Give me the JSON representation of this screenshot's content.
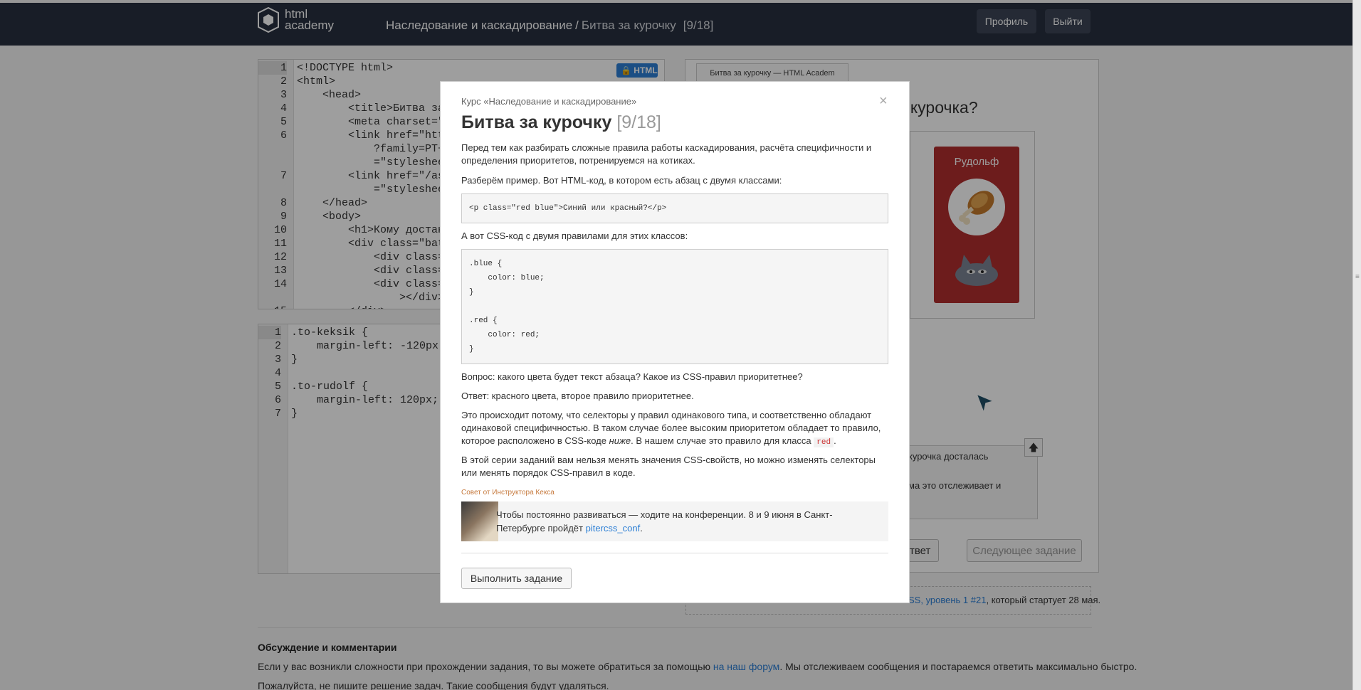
{
  "header": {
    "logo_line1": "html",
    "logo_line2": "academy",
    "breadcrumb_course": "Наследование и каскадирование",
    "breadcrumb_sep": "/",
    "breadcrumb_task": "Битва за курочку",
    "breadcrumb_count": "[9/18]",
    "profile_label": "Профиль",
    "logout_label": "Выйти"
  },
  "html_editor": {
    "badge": "HTML",
    "line_numbers": [
      "1",
      "2",
      "3",
      "4",
      "5",
      "6",
      "",
      "",
      "7",
      "",
      "8",
      "9",
      "10",
      "11",
      "12",
      "13",
      "14",
      "",
      "15"
    ],
    "lines": [
      "<!DOCTYPE html>",
      "<html>",
      "    <head>",
      "        <title>Битва за",
      "        <meta charset=\"",
      "        <link href=\"htt",
      "            ?family=PT+",
      "            =\"styleshee",
      "        <link href=\"/as",
      "            =\"styleshee",
      "    </head>",
      "    <body>",
      "        <h1>Кому достан",
      "        <div class=\"bat",
      "            <div class=",
      "            <div class=",
      "            <div class=",
      "                ></div>",
      "        </div>"
    ]
  },
  "css_editor": {
    "line_numbers": [
      "1",
      "2",
      "3",
      "4",
      "5",
      "6",
      "7"
    ],
    "lines": [
      ".to-keksik {",
      "    margin-left: -120px;",
      "}",
      "",
      ".to-rudolf {",
      "    margin-left: 120px;",
      "}"
    ]
  },
  "preview": {
    "tab_label": "Битва за курочку — HTML Academ",
    "heading": "я курочка?",
    "card_name": "Рудольф",
    "answer_line1": "курочка досталась",
    "answer_line2": "ма это отслеживает и",
    "up_arrow": "🡅",
    "answer_button": "твет",
    "next_button": "Следующее задание",
    "promo_link": "SS, уровень 1 #21",
    "promo_tail": ", который стартует 28 мая."
  },
  "discussion": {
    "heading": "Обсуждение и комментарии",
    "p1_start": "Если у вас возникли сложности при прохождении задания, то вы можете обратиться за помощью ",
    "p1_link": "на наш форум",
    "p1_end": ". Мы отслеживаем сообщения и постараемся ответить максимально быстро.",
    "p2": "Пожалуйста, не пишите решение задач. Такие сообщения будут удаляться."
  },
  "modal": {
    "course": "Курс «Наследование и каскадирование»",
    "close": "×",
    "title": "Битва за курочку",
    "title_count": "[9/18]",
    "intro": "Перед тем как разбирать сложные правила работы каскадирования, расчёта специфичности и определения приоритетов, потренируемся на котиках.",
    "example_intro": "Разберём пример. Вот HTML-код, в котором есть абзац с двумя классами:",
    "html_code": "<p class=\"red blue\">Синий или красный?</p>",
    "css_intro": "А вот CSS-код с двумя правилами для этих классов:",
    "css_code": ".blue {\n    color: blue;\n}\n\n.red {\n    color: red;\n}",
    "question": "Вопрос: какого цвета будет текст абзаца? Какое из CSS-правил приоритетнее?",
    "answer": "Ответ: красного цвета, второе правило приоритетнее.",
    "explain_start": "Это происходит потому, что селекторы у правил одинакового типа, и соответственно обладают одинаковой специфичностью. В таком случае более высоким приоритетом обладает то правило, которое расположено в CSS-коде ",
    "explain_em": "ниже",
    "explain_mid": ". В нашем случае это правило для класса ",
    "explain_code": "red",
    "explain_end": ".",
    "rule": "В этой серии заданий вам нельзя менять значения CSS-свойств, но можно изменять селекторы или менять порядок CSS-правил в коде.",
    "tip_label": "Совет от Инструктора Кекса",
    "tip_text": "Чтобы постоянно развиваться — ходите на конференции. 8 и 9 июня в Санкт-Петербурге пройдёт ",
    "tip_link": "pitercss_conf",
    "tip_end": ".",
    "do_button": "Выполнить задание"
  },
  "colors": {
    "header_bg": "#283040",
    "accent_blue": "#2c7fd5",
    "card_red": "#b02e2e",
    "tip_label": "#c67a3e"
  }
}
